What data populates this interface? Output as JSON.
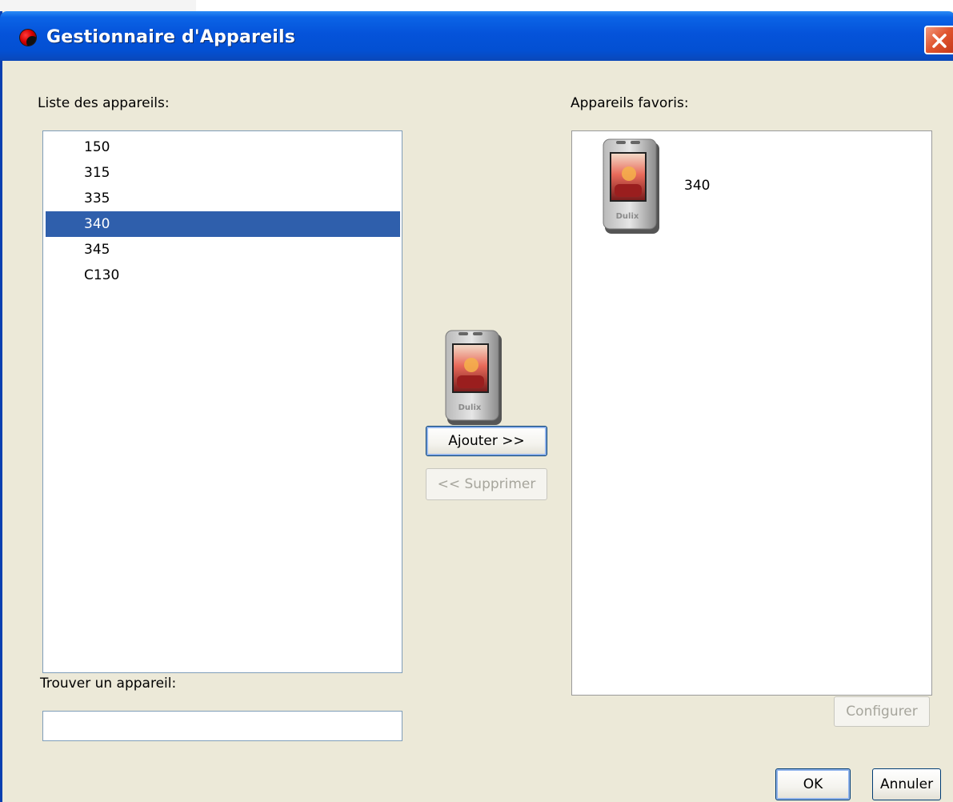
{
  "window": {
    "title": "Gestionnaire d'Appareils",
    "close_symbol": "✕"
  },
  "device_list": {
    "label": "Liste des appareils:",
    "items": [
      "150",
      "315",
      "335",
      "340",
      "345",
      "C130"
    ],
    "selected": "340"
  },
  "favorites": {
    "label": "Appareils favoris:",
    "items": [
      {
        "name": "340",
        "icon": "dulix-player-icon"
      }
    ]
  },
  "device_preview": {
    "icon": "dulix-player-icon",
    "brand": "Dulix"
  },
  "buttons": {
    "add": "Ajouter >>",
    "remove": "<< Supprimer",
    "configure": "Configurer",
    "ok": "OK",
    "cancel": "Annuler"
  },
  "search": {
    "label": "Trouver un appareil:",
    "value": ""
  },
  "colors": {
    "titlebar": "#0553da",
    "selection": "#2f5fac",
    "dialog_background": "#ece9d8",
    "close_button": "#e0542e"
  }
}
